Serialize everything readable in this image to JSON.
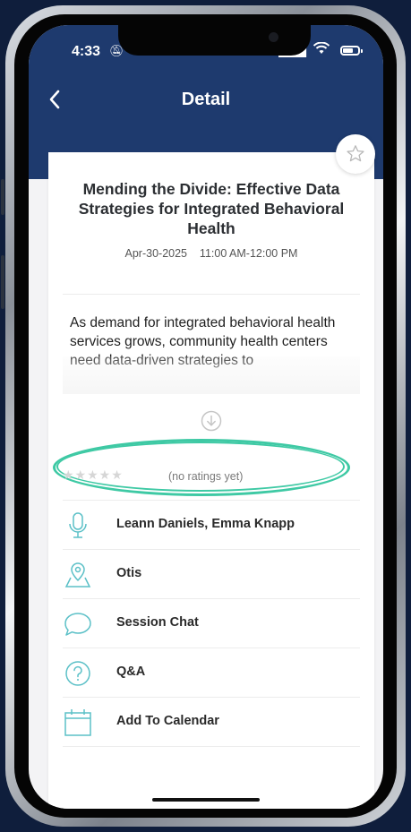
{
  "status_bar": {
    "time": "4:33"
  },
  "nav": {
    "title": "Detail"
  },
  "session": {
    "title": "Mending the Divide: Effective Data Strategies for Integrated Behavioral Health",
    "date": "Apr-30-2025",
    "time": "11:00 AM-12:00 PM",
    "description": "As demand for integrated behavioral health services grows, community health centers need data-driven strategies to"
  },
  "rating": {
    "stars": 0,
    "max_stars": 5,
    "text": "(no ratings yet)"
  },
  "list": {
    "speakers": "Leann Daniels, Emma Knapp",
    "location": "Otis",
    "chat": "Session Chat",
    "qa": "Q&A",
    "calendar": "Add To Calendar"
  },
  "colors": {
    "brand": "#1e3a6e",
    "accent": "#3ec9a4",
    "icon": "#5bc0c7"
  }
}
